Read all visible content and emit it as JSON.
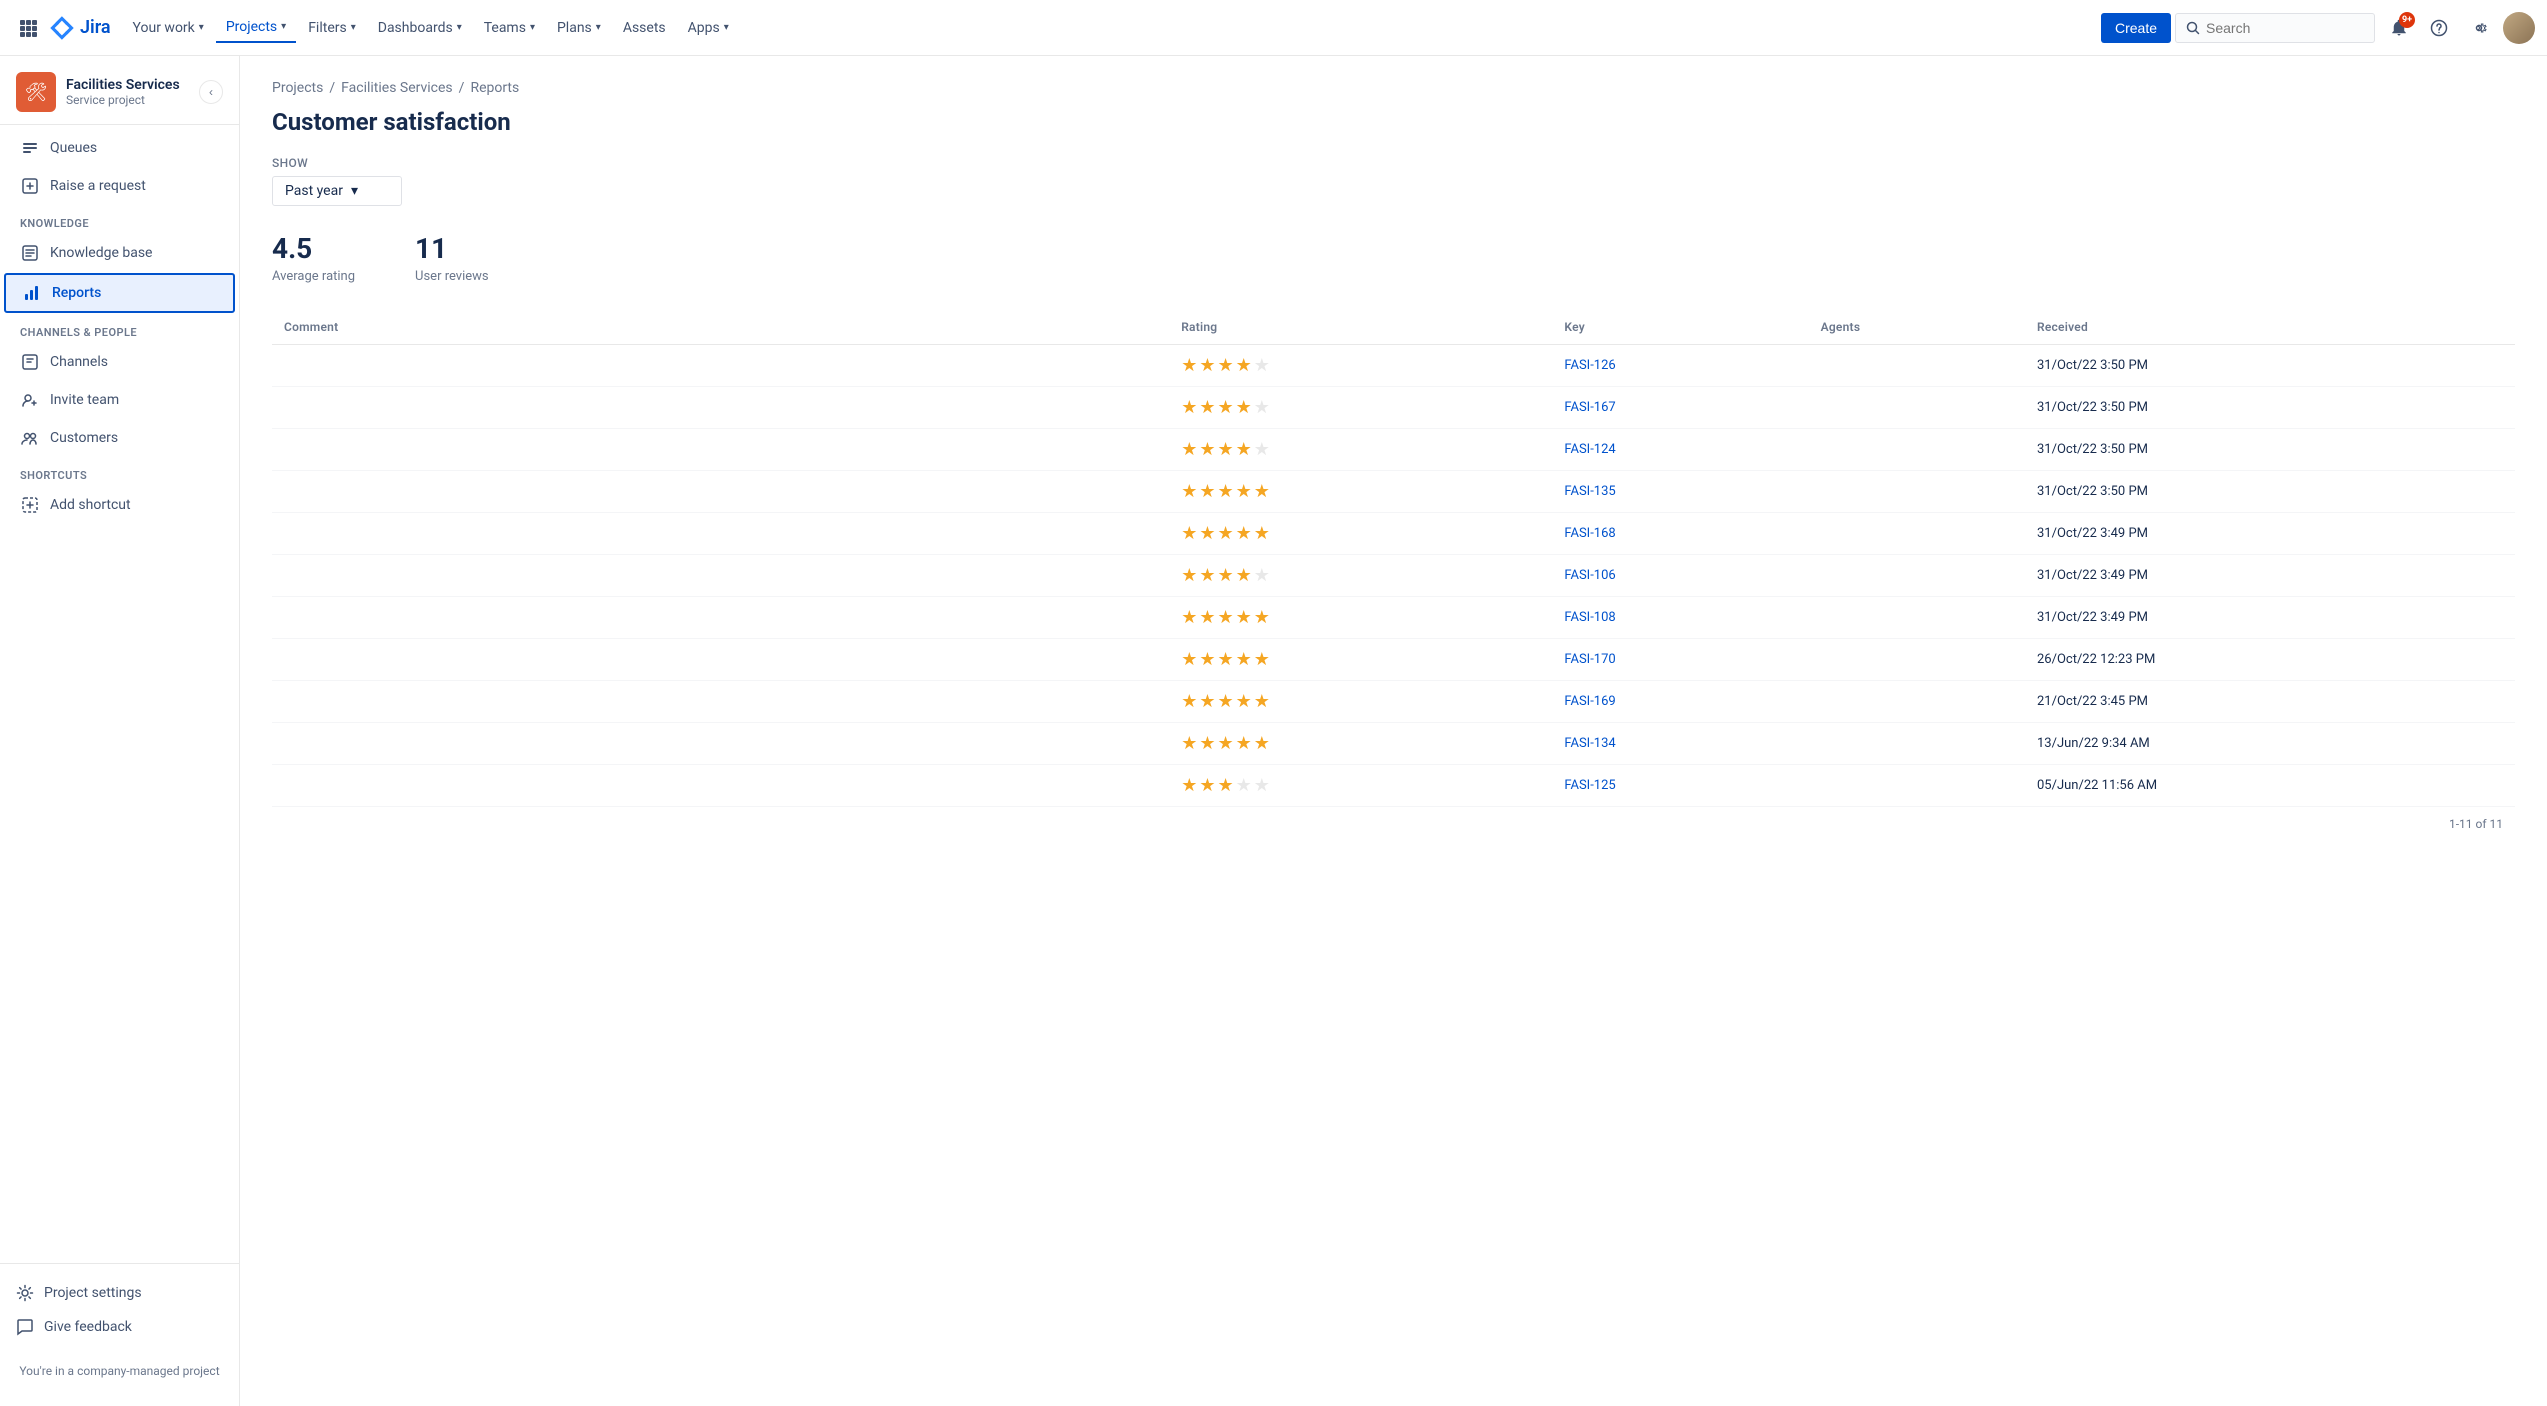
{
  "topnav": {
    "logo_text": "Jira",
    "nav_items": [
      {
        "label": "Your work",
        "has_chevron": true,
        "active": false
      },
      {
        "label": "Projects",
        "has_chevron": true,
        "active": true
      },
      {
        "label": "Filters",
        "has_chevron": true,
        "active": false
      },
      {
        "label": "Dashboards",
        "has_chevron": true,
        "active": false
      },
      {
        "label": "Teams",
        "has_chevron": true,
        "active": false
      },
      {
        "label": "Plans",
        "has_chevron": true,
        "active": false
      },
      {
        "label": "Assets",
        "has_chevron": false,
        "active": false
      },
      {
        "label": "Apps",
        "has_chevron": true,
        "active": false
      }
    ],
    "create_label": "Create",
    "search_placeholder": "Search",
    "notification_count": "9+"
  },
  "sidebar": {
    "project_name": "Facilities Services",
    "project_type": "Service project",
    "items_main": [
      {
        "label": "Queues",
        "icon": "queues"
      },
      {
        "label": "Raise a request",
        "icon": "raise-request"
      }
    ],
    "knowledge_section_label": "KNOWLEDGE",
    "knowledge_items": [
      {
        "label": "Knowledge base",
        "icon": "knowledge-base"
      },
      {
        "label": "Reports",
        "icon": "reports",
        "active": true
      }
    ],
    "channels_section_label": "CHANNELS & PEOPLE",
    "channels_items": [
      {
        "label": "Channels",
        "icon": "channels"
      },
      {
        "label": "Invite team",
        "icon": "invite-team"
      },
      {
        "label": "Customers",
        "icon": "customers"
      }
    ],
    "shortcuts_section_label": "SHORTCUTS",
    "shortcuts_items": [
      {
        "label": "Add shortcut",
        "icon": "add-shortcut"
      }
    ],
    "footer_items": [
      {
        "label": "Project settings",
        "icon": "settings"
      },
      {
        "label": "Give feedback",
        "icon": "feedback"
      }
    ],
    "company_notice": "You're in a company-managed project"
  },
  "breadcrumb": {
    "items": [
      "Projects",
      "Facilities Services",
      "Reports"
    ]
  },
  "page": {
    "title": "Customer satisfaction",
    "show_label": "Show",
    "period_value": "Past year",
    "avg_rating_value": "4.5",
    "avg_rating_label": "Average rating",
    "user_reviews_value": "11",
    "user_reviews_label": "User reviews"
  },
  "table": {
    "headers": [
      "Comment",
      "Rating",
      "Key",
      "Agents",
      "Received"
    ],
    "rows": [
      {
        "comment": "",
        "rating": 4,
        "key": "FASI-126",
        "agents": "",
        "received": "31/Oct/22 3:50 PM"
      },
      {
        "comment": "",
        "rating": 4,
        "key": "FASI-167",
        "agents": "",
        "received": "31/Oct/22 3:50 PM"
      },
      {
        "comment": "",
        "rating": 4,
        "key": "FASI-124",
        "agents": "",
        "received": "31/Oct/22 3:50 PM"
      },
      {
        "comment": "",
        "rating": 5,
        "key": "FASI-135",
        "agents": "",
        "received": "31/Oct/22 3:50 PM"
      },
      {
        "comment": "",
        "rating": 5,
        "key": "FASI-168",
        "agents": "",
        "received": "31/Oct/22 3:49 PM"
      },
      {
        "comment": "",
        "rating": 4,
        "key": "FASI-106",
        "agents": "",
        "received": "31/Oct/22 3:49 PM"
      },
      {
        "comment": "",
        "rating": 5,
        "key": "FASI-108",
        "agents": "",
        "received": "31/Oct/22 3:49 PM"
      },
      {
        "comment": "",
        "rating": 5,
        "key": "FASI-170",
        "agents": "",
        "received": "26/Oct/22 12:23 PM"
      },
      {
        "comment": "",
        "rating": 5,
        "key": "FASI-169",
        "agents": "",
        "received": "21/Oct/22 3:45 PM"
      },
      {
        "comment": "",
        "rating": 5,
        "key": "FASI-134",
        "agents": "",
        "received": "13/Jun/22 9:34 AM"
      },
      {
        "comment": "",
        "rating": 3,
        "key": "FASI-125",
        "agents": "",
        "received": "05/Jun/22 11:56 AM"
      }
    ],
    "pagination": "1-11 of 11"
  }
}
